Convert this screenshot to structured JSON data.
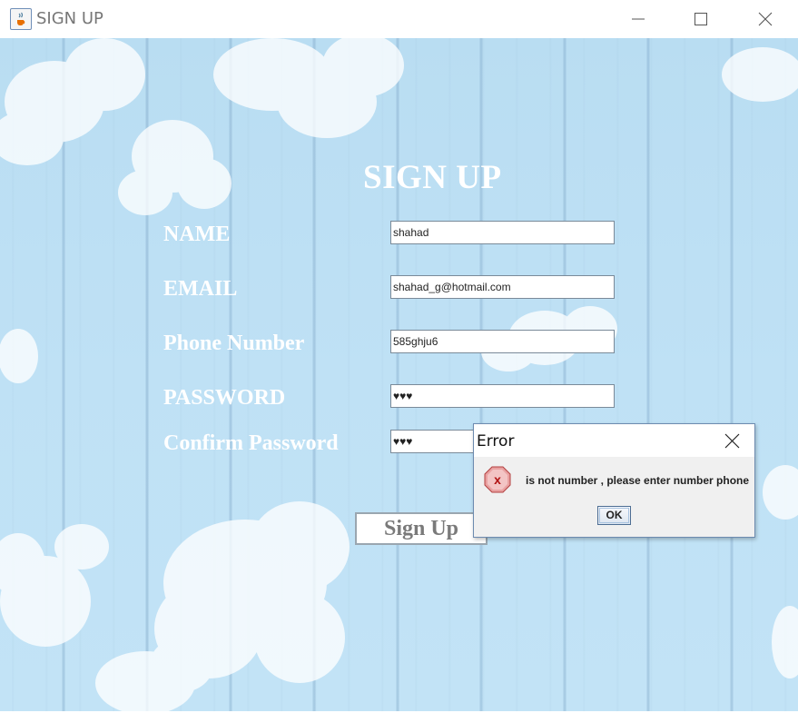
{
  "window": {
    "title": "SIGN UP",
    "icon": "java-cup-icon",
    "controls": [
      "minimize-icon",
      "maximize-icon",
      "close-icon"
    ]
  },
  "form": {
    "heading": "SIGN UP",
    "fields": [
      {
        "label": "NAME",
        "value": "shahad"
      },
      {
        "label": "EMAIL",
        "value": "shahad_g@hotmail.com"
      },
      {
        "label": "Phone Number",
        "value": "585ghju6"
      },
      {
        "label": "PASSWORD",
        "value": "♥♥♥"
      },
      {
        "label": "Confirm Password",
        "value": "♥♥♥"
      }
    ],
    "submit_label": "Sign Up"
  },
  "dialog": {
    "title": "Error",
    "message": "is not number , please enter number phone",
    "ok_label": "OK",
    "icon": "error-icon"
  },
  "colors": {
    "background_blue": "#bfe1f5",
    "label_text": "#ffffff",
    "error_icon": "#d9534f"
  }
}
